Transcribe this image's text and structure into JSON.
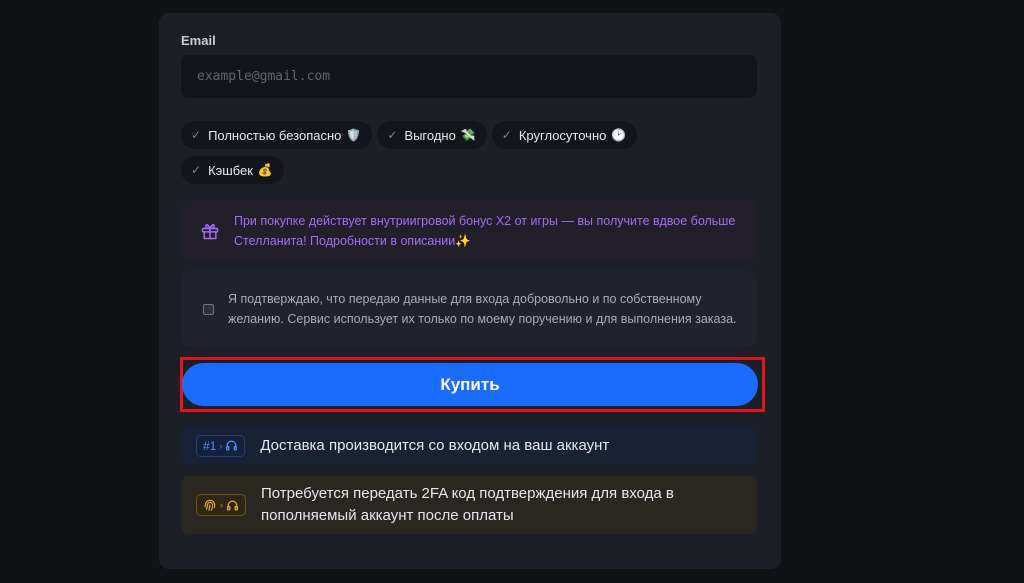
{
  "form": {
    "email_label": "Email",
    "email_placeholder": "example@gmail.com",
    "email_value": ""
  },
  "chips": [
    {
      "label": "Полностью безопасно",
      "emoji": "🛡️"
    },
    {
      "label": "Выгодно",
      "emoji": "💸"
    },
    {
      "label": "Круглосуточно",
      "emoji": "🕑"
    },
    {
      "label": "Кэшбек",
      "emoji": "💰"
    }
  ],
  "bonus": {
    "text": "При покупке действует внутриигровой бонус X2 от игры — вы получите вдвое больше Стелланита! Подробности в описании✨",
    "icon": "gift-icon",
    "color": "#a36cf5"
  },
  "consent": {
    "checked": false,
    "text": "Я подтверждаю, что передаю данные для входа добровольно и по собственному желанию. Сервис использует их только по моему поручению и для выполнения заказа."
  },
  "buy_button": {
    "label": "Купить",
    "color": "#1a6cff",
    "highlight_color": "#e3141f"
  },
  "info": [
    {
      "badge": "#1",
      "badge_icon": "headphones-icon",
      "text": "Доставка производится со входом на ваш аккаунт",
      "color": "#4f8bff"
    },
    {
      "badge_icon": "fingerprint-icon",
      "badge_icon2": "headphones-icon",
      "text": "Потребуется передать 2FA код подтверждения для входа в пополняемый аккаунт после оплаты",
      "color": "#e3ab2a"
    }
  ]
}
